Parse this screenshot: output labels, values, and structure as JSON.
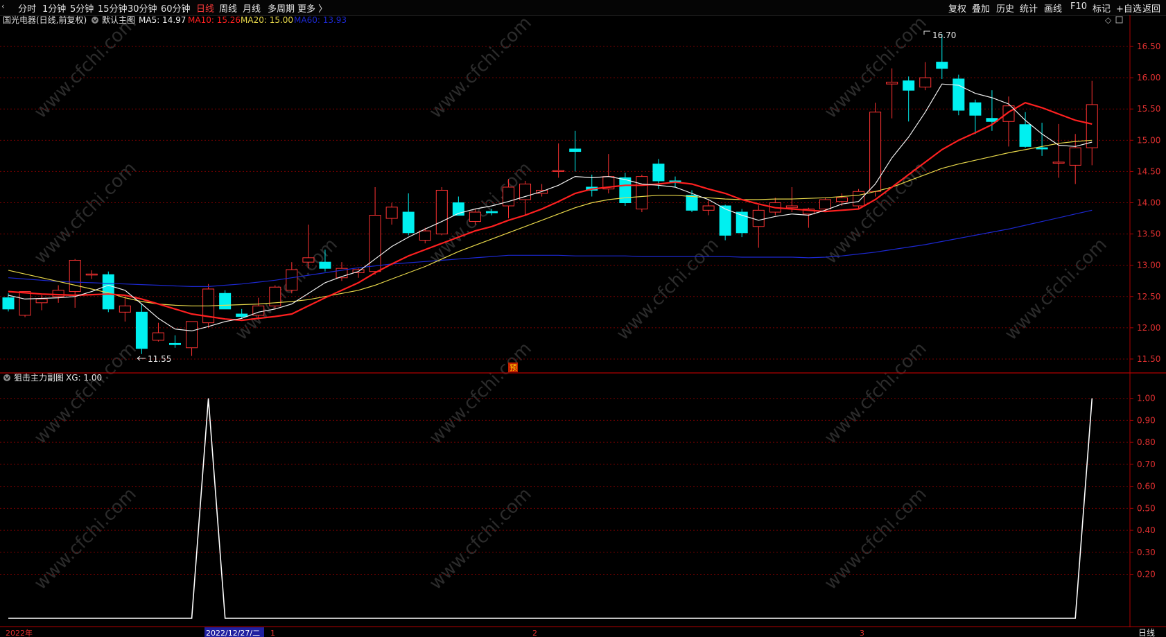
{
  "toolbar": {
    "menu_icon": "‹",
    "tabs": [
      {
        "label": "分时",
        "active": false
      },
      {
        "label": "1分钟",
        "active": false
      },
      {
        "label": "5分钟",
        "active": false
      },
      {
        "label": "15分钟",
        "active": false
      },
      {
        "label": "30分钟",
        "active": false
      },
      {
        "label": "60分钟",
        "active": false
      },
      {
        "label": "日线",
        "active": true
      },
      {
        "label": "周线",
        "active": false
      },
      {
        "label": "月线",
        "active": false
      },
      {
        "label": "多周期",
        "active": false
      },
      {
        "label": "更多 〉",
        "active": false
      }
    ],
    "right_buttons": [
      "复权",
      "叠加",
      "历史",
      "统计",
      "画线",
      "F10",
      "标记",
      "+自选",
      "返回"
    ]
  },
  "colors": {
    "up": "#ff3333",
    "down": "#00f0f0",
    "ma5": "#f0f0f0",
    "ma10": "#ff2020",
    "ma20": "#e8d84a",
    "ma60": "#1c28d0",
    "grid": "#7a0000",
    "border": "#b00000"
  },
  "main_legend": {
    "title": "国光电器(日线,前复权)",
    "indicator": "默认主图",
    "ma5": "MA5: 14.97",
    "ma10": "MA10: 15.26",
    "ma20": "MA20: 15.00",
    "ma60": "MA60: 13.93"
  },
  "sub_legend": {
    "title": "狙击主力副图",
    "value": "XG: 1.00"
  },
  "watermark": "www.cfchi.com",
  "bottom_bar": {
    "year": "2022年",
    "cursor_date": "2022/12/27/二",
    "months": [
      "1",
      "2",
      "3"
    ],
    "period": "日线"
  },
  "yu_mark": "预",
  "chart_data": [
    {
      "type": "candlestick",
      "title": "国光电器(日线,前复权)",
      "ylim": [
        11.3,
        16.8
      ],
      "yticks": [
        11.5,
        12.0,
        12.5,
        13.0,
        13.5,
        14.0,
        14.5,
        15.0,
        15.5,
        16.0,
        16.5
      ],
      "high_label": "16.70",
      "low_label": "11.55",
      "candles": [
        {
          "o": 12.48,
          "h": 12.55,
          "l": 12.26,
          "c": 12.3
        },
        {
          "o": 12.2,
          "h": 12.58,
          "l": 12.17,
          "c": 12.58
        },
        {
          "o": 12.4,
          "h": 12.52,
          "l": 12.28,
          "c": 12.46
        },
        {
          "o": 12.5,
          "h": 12.68,
          "l": 12.4,
          "c": 12.6
        },
        {
          "o": 12.58,
          "h": 13.1,
          "l": 12.32,
          "c": 13.08
        },
        {
          "o": 12.85,
          "h": 12.92,
          "l": 12.78,
          "c": 12.86
        },
        {
          "o": 12.85,
          "h": 12.9,
          "l": 12.25,
          "c": 12.3
        },
        {
          "o": 12.25,
          "h": 12.5,
          "l": 12.1,
          "c": 12.35
        },
        {
          "o": 12.25,
          "h": 12.38,
          "l": 11.58,
          "c": 11.67
        },
        {
          "o": 11.8,
          "h": 12.08,
          "l": 11.78,
          "c": 11.92
        },
        {
          "o": 11.75,
          "h": 11.88,
          "l": 11.68,
          "c": 11.73
        },
        {
          "o": 11.68,
          "h": 12.1,
          "l": 11.55,
          "c": 12.1
        },
        {
          "o": 12.08,
          "h": 12.7,
          "l": 12.0,
          "c": 12.62
        },
        {
          "o": 12.55,
          "h": 12.6,
          "l": 12.3,
          "c": 12.3
        },
        {
          "o": 12.22,
          "h": 12.3,
          "l": 12.15,
          "c": 12.18
        },
        {
          "o": 12.2,
          "h": 12.48,
          "l": 12.15,
          "c": 12.35
        },
        {
          "o": 12.35,
          "h": 12.68,
          "l": 12.3,
          "c": 12.65
        },
        {
          "o": 12.6,
          "h": 13.05,
          "l": 12.55,
          "c": 12.93
        },
        {
          "o": 13.05,
          "h": 13.65,
          "l": 12.95,
          "c": 13.12
        },
        {
          "o": 13.05,
          "h": 13.25,
          "l": 12.9,
          "c": 12.95
        },
        {
          "o": 12.8,
          "h": 13.05,
          "l": 12.75,
          "c": 12.95
        },
        {
          "o": 12.88,
          "h": 12.95,
          "l": 12.8,
          "c": 12.93
        },
        {
          "o": 12.9,
          "h": 14.25,
          "l": 12.85,
          "c": 13.8
        },
        {
          "o": 13.75,
          "h": 14.0,
          "l": 13.65,
          "c": 13.93
        },
        {
          "o": 13.85,
          "h": 14.15,
          "l": 13.48,
          "c": 13.52
        },
        {
          "o": 13.4,
          "h": 13.6,
          "l": 13.35,
          "c": 13.55
        },
        {
          "o": 13.5,
          "h": 14.25,
          "l": 13.48,
          "c": 14.2
        },
        {
          "o": 14.0,
          "h": 14.1,
          "l": 13.8,
          "c": 13.8
        },
        {
          "o": 13.7,
          "h": 13.9,
          "l": 13.65,
          "c": 13.85
        },
        {
          "o": 13.86,
          "h": 13.9,
          "l": 13.8,
          "c": 13.84
        },
        {
          "o": 13.95,
          "h": 14.38,
          "l": 13.75,
          "c": 14.25
        },
        {
          "o": 14.05,
          "h": 14.35,
          "l": 13.8,
          "c": 14.3
        },
        {
          "o": 14.15,
          "h": 14.3,
          "l": 14.1,
          "c": 14.2
        },
        {
          "o": 14.5,
          "h": 14.95,
          "l": 14.4,
          "c": 14.52
        },
        {
          "o": 14.86,
          "h": 15.15,
          "l": 14.5,
          "c": 14.82
        },
        {
          "o": 14.25,
          "h": 14.45,
          "l": 14.1,
          "c": 14.2
        },
        {
          "o": 14.22,
          "h": 14.78,
          "l": 14.15,
          "c": 14.42
        },
        {
          "o": 14.4,
          "h": 14.48,
          "l": 13.95,
          "c": 14.0
        },
        {
          "o": 13.9,
          "h": 14.45,
          "l": 13.85,
          "c": 14.42
        },
        {
          "o": 14.62,
          "h": 14.7,
          "l": 14.22,
          "c": 14.35
        },
        {
          "o": 14.35,
          "h": 14.42,
          "l": 14.25,
          "c": 14.32
        },
        {
          "o": 14.12,
          "h": 14.2,
          "l": 13.85,
          "c": 13.88
        },
        {
          "o": 13.88,
          "h": 14.05,
          "l": 13.8,
          "c": 13.95
        },
        {
          "o": 13.95,
          "h": 13.97,
          "l": 13.4,
          "c": 13.48
        },
        {
          "o": 13.85,
          "h": 13.9,
          "l": 13.45,
          "c": 13.52
        },
        {
          "o": 13.62,
          "h": 13.96,
          "l": 13.28,
          "c": 13.88
        },
        {
          "o": 13.85,
          "h": 14.08,
          "l": 13.8,
          "c": 14.0
        },
        {
          "o": 13.92,
          "h": 14.25,
          "l": 13.85,
          "c": 13.95
        },
        {
          "o": 13.82,
          "h": 13.92,
          "l": 13.6,
          "c": 13.9
        },
        {
          "o": 13.9,
          "h": 14.08,
          "l": 13.85,
          "c": 14.05
        },
        {
          "o": 14.02,
          "h": 14.15,
          "l": 13.95,
          "c": 14.08
        },
        {
          "o": 13.95,
          "h": 14.22,
          "l": 13.9,
          "c": 14.18
        },
        {
          "o": 14.18,
          "h": 15.6,
          "l": 14.1,
          "c": 15.45
        },
        {
          "o": 15.9,
          "h": 16.15,
          "l": 15.35,
          "c": 15.93
        },
        {
          "o": 15.95,
          "h": 16.02,
          "l": 15.3,
          "c": 15.8
        },
        {
          "o": 15.85,
          "h": 16.25,
          "l": 15.8,
          "c": 16.0
        },
        {
          "o": 16.25,
          "h": 16.7,
          "l": 15.98,
          "c": 16.15
        },
        {
          "o": 15.98,
          "h": 16.05,
          "l": 15.4,
          "c": 15.48
        },
        {
          "o": 15.6,
          "h": 15.65,
          "l": 15.1,
          "c": 15.4
        },
        {
          "o": 15.35,
          "h": 15.8,
          "l": 15.15,
          "c": 15.3
        },
        {
          "o": 15.3,
          "h": 15.7,
          "l": 14.9,
          "c": 15.55
        },
        {
          "o": 15.25,
          "h": 15.45,
          "l": 14.88,
          "c": 14.9
        },
        {
          "o": 14.88,
          "h": 15.28,
          "l": 14.75,
          "c": 14.86
        },
        {
          "o": 14.65,
          "h": 15.26,
          "l": 14.4,
          "c": 14.65
        },
        {
          "o": 14.6,
          "h": 15.1,
          "l": 14.3,
          "c": 14.88
        },
        {
          "o": 14.88,
          "h": 15.95,
          "l": 14.6,
          "c": 15.57
        }
      ],
      "ma5": [
        12.52,
        12.46,
        12.47,
        12.48,
        12.5,
        12.58,
        12.68,
        12.6,
        12.38,
        12.15,
        11.98,
        11.95,
        12.02,
        12.1,
        12.15,
        12.25,
        12.3,
        12.38,
        12.55,
        12.72,
        12.82,
        12.9,
        13.1,
        13.3,
        13.45,
        13.58,
        13.7,
        13.83,
        13.9,
        13.95,
        14.02,
        14.1,
        14.18,
        14.28,
        14.42,
        14.4,
        14.42,
        14.37,
        14.3,
        14.28,
        14.25,
        14.15,
        14.05,
        13.9,
        13.8,
        13.72,
        13.78,
        13.82,
        13.8,
        13.88,
        13.98,
        14.02,
        14.3,
        14.72,
        15.05,
        15.45,
        15.9,
        15.88,
        15.75,
        15.68,
        15.58,
        15.32,
        15.1,
        14.92,
        14.9,
        14.97
      ],
      "ma10": [
        12.58,
        12.56,
        12.54,
        12.53,
        12.52,
        12.53,
        12.54,
        12.52,
        12.46,
        12.38,
        12.3,
        12.22,
        12.18,
        12.14,
        12.12,
        12.15,
        12.18,
        12.22,
        12.35,
        12.48,
        12.6,
        12.72,
        12.88,
        13.02,
        13.15,
        13.25,
        13.35,
        13.45,
        13.55,
        13.62,
        13.72,
        13.8,
        13.9,
        14.02,
        14.15,
        14.22,
        14.25,
        14.28,
        14.28,
        14.3,
        14.33,
        14.3,
        14.22,
        14.15,
        14.05,
        13.98,
        13.92,
        13.9,
        13.88,
        13.86,
        13.88,
        13.9,
        14.05,
        14.25,
        14.45,
        14.65,
        14.85,
        15.0,
        15.12,
        15.25,
        15.45,
        15.6,
        15.52,
        15.42,
        15.32,
        15.26
      ],
      "ma20": [
        12.92,
        12.86,
        12.8,
        12.74,
        12.68,
        12.62,
        12.56,
        12.48,
        12.42,
        12.38,
        12.36,
        12.35,
        12.35,
        12.36,
        12.37,
        12.38,
        12.4,
        12.42,
        12.45,
        12.5,
        12.55,
        12.6,
        12.68,
        12.78,
        12.88,
        12.98,
        13.1,
        13.22,
        13.32,
        13.42,
        13.52,
        13.62,
        13.72,
        13.82,
        13.92,
        14.0,
        14.05,
        14.08,
        14.1,
        14.12,
        14.12,
        14.1,
        14.08,
        14.06,
        14.05,
        14.05,
        14.06,
        14.06,
        14.07,
        14.08,
        14.1,
        14.12,
        14.18,
        14.25,
        14.35,
        14.45,
        14.55,
        14.62,
        14.68,
        14.74,
        14.8,
        14.85,
        14.9,
        14.95,
        14.98,
        15.0
      ],
      "ma60": [
        12.8,
        12.78,
        12.76,
        12.74,
        12.73,
        12.72,
        12.71,
        12.7,
        12.69,
        12.68,
        12.67,
        12.66,
        12.66,
        12.68,
        12.7,
        12.73,
        12.76,
        12.8,
        12.84,
        12.88,
        12.92,
        12.96,
        12.99,
        13.02,
        13.04,
        13.06,
        13.08,
        13.1,
        13.12,
        13.14,
        13.16,
        13.16,
        13.16,
        13.16,
        13.15,
        13.15,
        13.15,
        13.15,
        13.14,
        13.14,
        13.14,
        13.14,
        13.14,
        13.14,
        13.13,
        13.13,
        13.13,
        13.13,
        13.12,
        13.13,
        13.15,
        13.18,
        13.21,
        13.25,
        13.29,
        13.33,
        13.38,
        13.43,
        13.48,
        13.53,
        13.58,
        13.64,
        13.7,
        13.76,
        13.82,
        13.88
      ]
    },
    {
      "type": "line",
      "title": "狙击主力副图",
      "series": [
        {
          "name": "XG",
          "values": [
            0,
            0,
            0,
            0,
            0,
            0,
            0,
            0,
            0,
            0,
            0,
            0,
            1,
            0,
            0,
            0,
            0,
            0,
            0,
            0,
            0,
            0,
            0,
            0,
            0,
            0,
            0,
            0,
            0,
            0,
            0,
            0,
            0,
            0,
            0,
            0,
            0,
            0,
            0,
            0,
            0,
            0,
            0,
            0,
            0,
            0,
            0,
            0,
            0,
            0,
            0,
            0,
            0,
            0,
            0,
            0,
            0,
            0,
            0,
            0,
            0,
            0,
            0,
            0,
            0,
            1
          ]
        }
      ],
      "ylim": [
        0,
        1.04
      ],
      "yticks": [
        0.2,
        0.3,
        0.4,
        0.5,
        0.6,
        0.7,
        0.8,
        0.9,
        1.0
      ]
    }
  ]
}
